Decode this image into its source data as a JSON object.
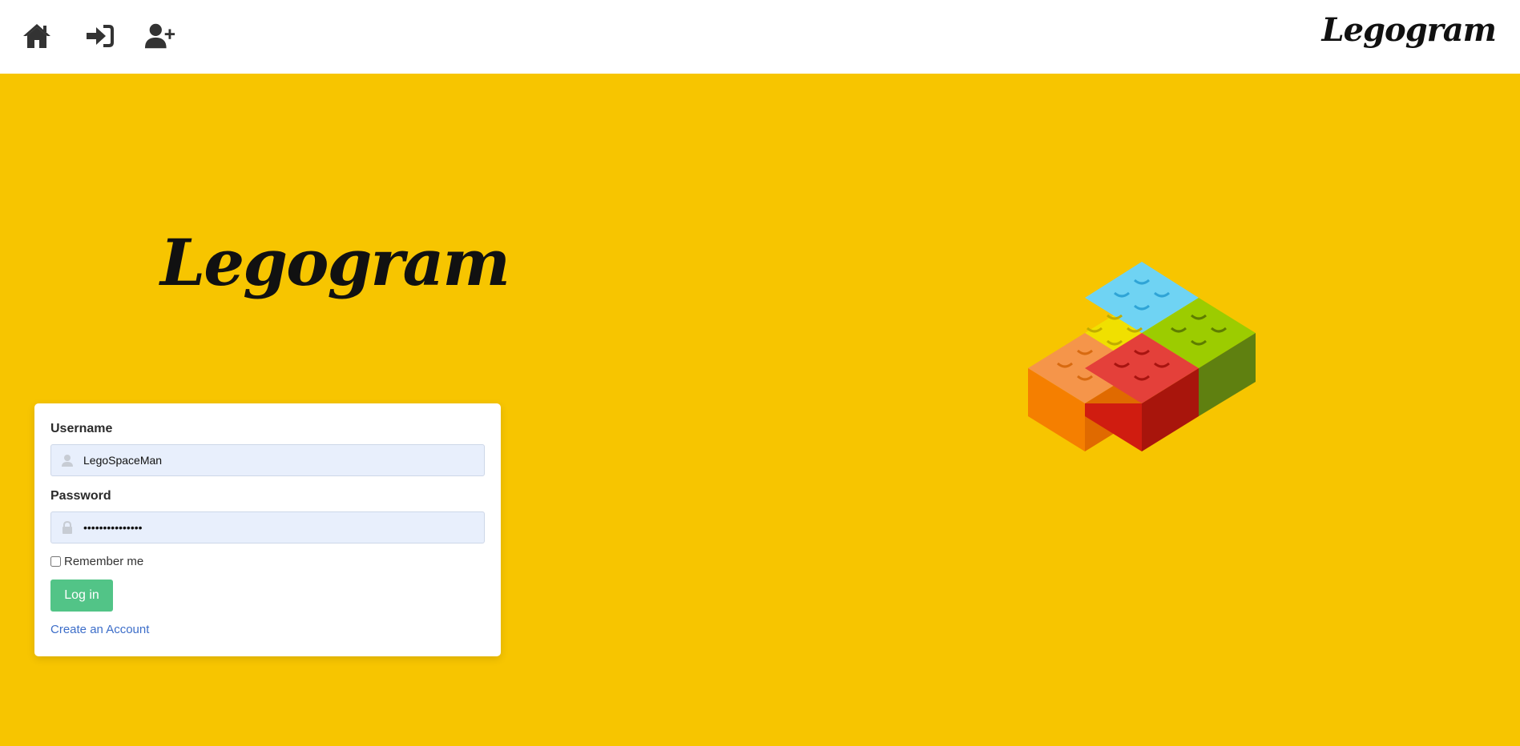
{
  "navbar": {
    "home_icon": "home-icon",
    "login_icon": "sign-in-icon",
    "register_icon": "user-plus-icon",
    "brand": "Legogram"
  },
  "hero": {
    "brand": "Legogram",
    "illustration": "lego-bricks"
  },
  "login_form": {
    "username_label": "Username",
    "username_value": "LegoSpaceMan",
    "password_label": "Password",
    "password_value": "LegoSpaceMan123",
    "remember_label": "Remember me",
    "remember_checked": false,
    "login_button": "Log in",
    "create_account_link": "Create an Account"
  },
  "colors": {
    "background": "#f7c500",
    "navbar": "#ffffff",
    "button": "#52c487",
    "link": "#3d6ec9",
    "input_bg": "#e8effc"
  }
}
